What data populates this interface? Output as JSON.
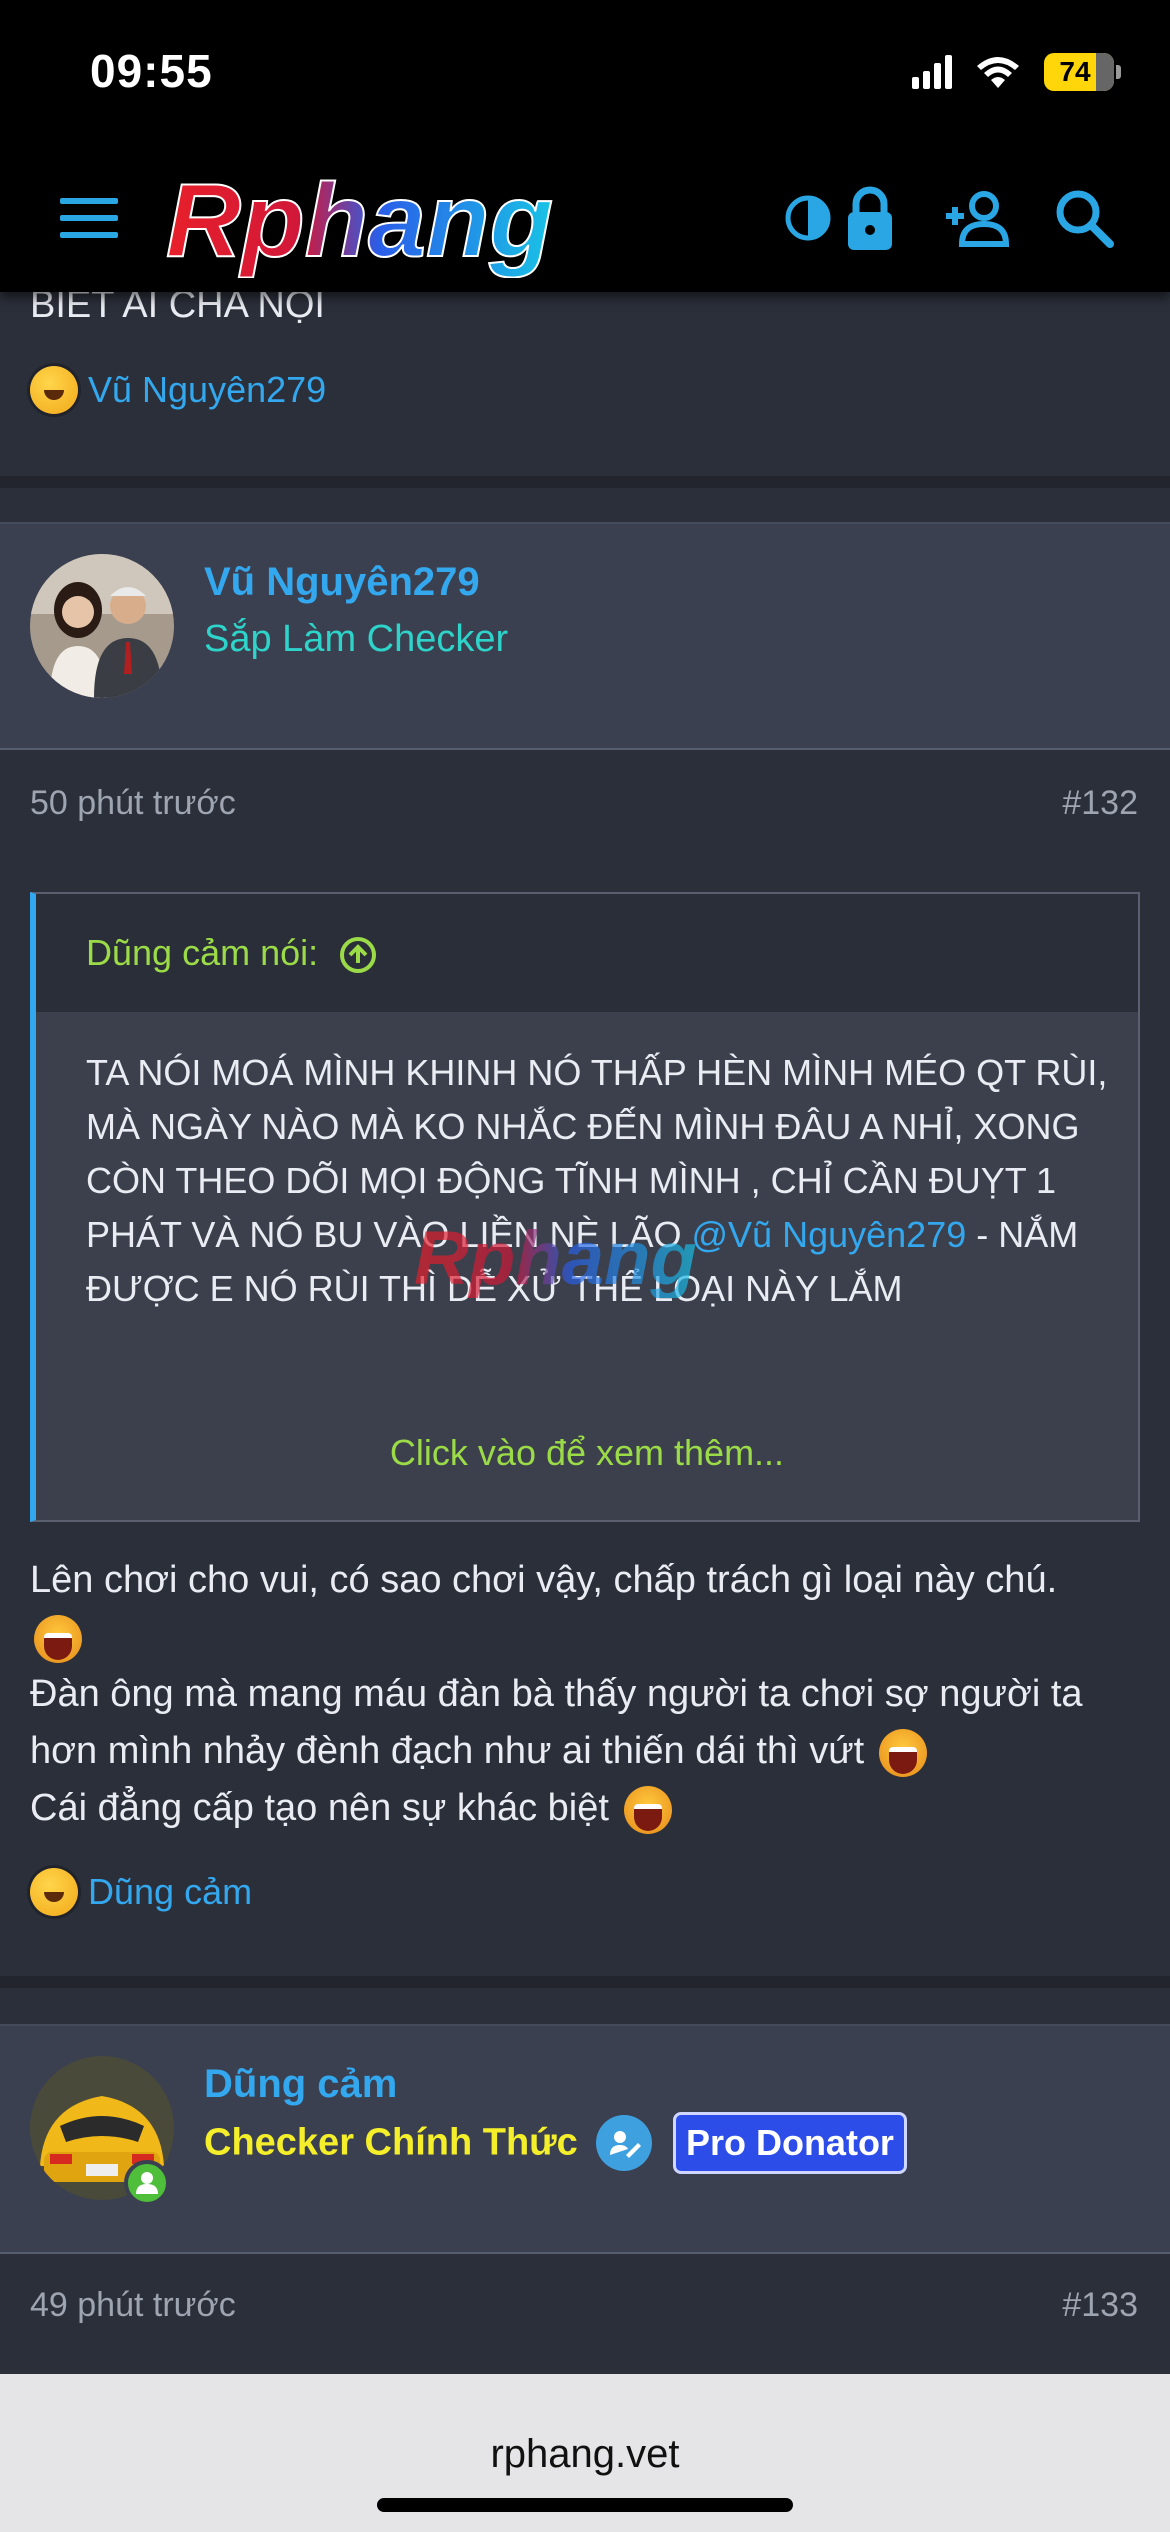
{
  "status": {
    "time": "09:55",
    "battery": "74",
    "battery_level": 0.74
  },
  "header": {
    "logo_text": "Rphang"
  },
  "prev_post": {
    "text_tail": "BIẾT AI CHA NỘI",
    "reaction_user": "Vũ Nguyên279"
  },
  "post132": {
    "author": "Vũ Nguyên279",
    "user_title": "Sắp Làm Checker",
    "time": "50 phút trước",
    "number": "#132",
    "quote": {
      "author": "Dũng cảm nói:",
      "text_a": "TA NÓI MOÁ MÌNH KHINH NÓ THẤP HÈN MÌNH MÉO QT RÙI, MÀ NGÀY NÀO MÀ KO NHẮC ĐẾN MÌNH ĐÂU A NHỈ, XONG CÒN THEO DÕI MỌI ĐỘNG TĨNH MÌNH , CHỈ CẦN ĐUỴT 1 PHÁT VÀ NÓ BU VÀO LIỀN NÈ LÃO ",
      "mention": "@Vũ Nguyên279",
      "text_b": " - NẮM ĐƯỢC E NÓ RÙI THÌ DỄ XỬ THỂ LOẠI NÀY LẮM",
      "expand": "Click vào để xem thêm..."
    },
    "message": {
      "line1": "Lên chơi cho vui, có sao chơi vậy, chấp trách gì loại này chú.",
      "line2": "Đàn ông mà mang máu đàn bà thấy người ta chơi sợ người ta hơn mình nhảy đènh đạch như ai thiến dái thì vứt",
      "line3": "Cái đẳng cấp tạo nên sự khác biệt"
    },
    "reaction_user": "Dũng cảm"
  },
  "post133": {
    "author": "Dũng cảm",
    "user_title": "Checker Chính Thức",
    "badge": "Pro Donator",
    "time": "49 phút trước",
    "number": "#133"
  },
  "browser": {
    "url": "rphang.vet"
  },
  "colors": {
    "accent": "#34a8ef",
    "title_green": "#2ed3c9",
    "title_yellow": "#f4ef2a",
    "quote_green": "#9bdb47"
  }
}
